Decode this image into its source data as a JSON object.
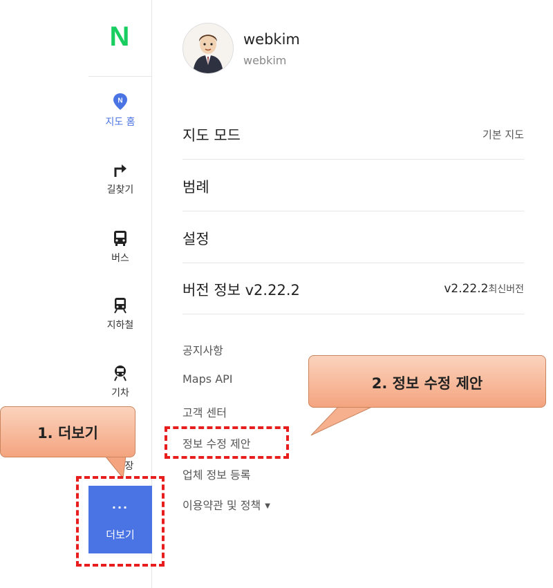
{
  "sidebar": {
    "logo": "N",
    "items": [
      {
        "label": "지도 홈",
        "icon": "map-pin-icon",
        "active": true
      },
      {
        "label": "길찾기",
        "icon": "turn-right-arrow-icon"
      },
      {
        "label": "버스",
        "icon": "bus-icon"
      },
      {
        "label": "지하철",
        "icon": "subway-icon"
      },
      {
        "label": "기차",
        "icon": "train-icon"
      },
      {
        "label": "장",
        "icon": "",
        "partially_hidden": true
      }
    ],
    "more": {
      "dots": "···",
      "label": "더보기"
    },
    "accent_color": "#4a74e3",
    "logo_color": "#19ce60"
  },
  "profile": {
    "name": "webkim",
    "id": "webkim",
    "avatar_icon": "avatar-icon"
  },
  "menu": [
    {
      "title": "지도 모드",
      "value": "기본 지도"
    },
    {
      "title": "범례",
      "value": ""
    },
    {
      "title": "설정",
      "value": ""
    },
    {
      "title": "버전 정보 v2.22.2",
      "value_version": "v2.22.2",
      "value_suffix": "최신버전"
    }
  ],
  "links": [
    "공지사항",
    "Maps API",
    "고객 센터",
    "정보 수정 제안",
    "업체 정보 등록",
    "이용약관 및 정책"
  ],
  "annotations": {
    "callout_1": "1. 더보기",
    "callout_2": "2. 정보 수정 제안",
    "highlight_color": "#e81e1e"
  }
}
